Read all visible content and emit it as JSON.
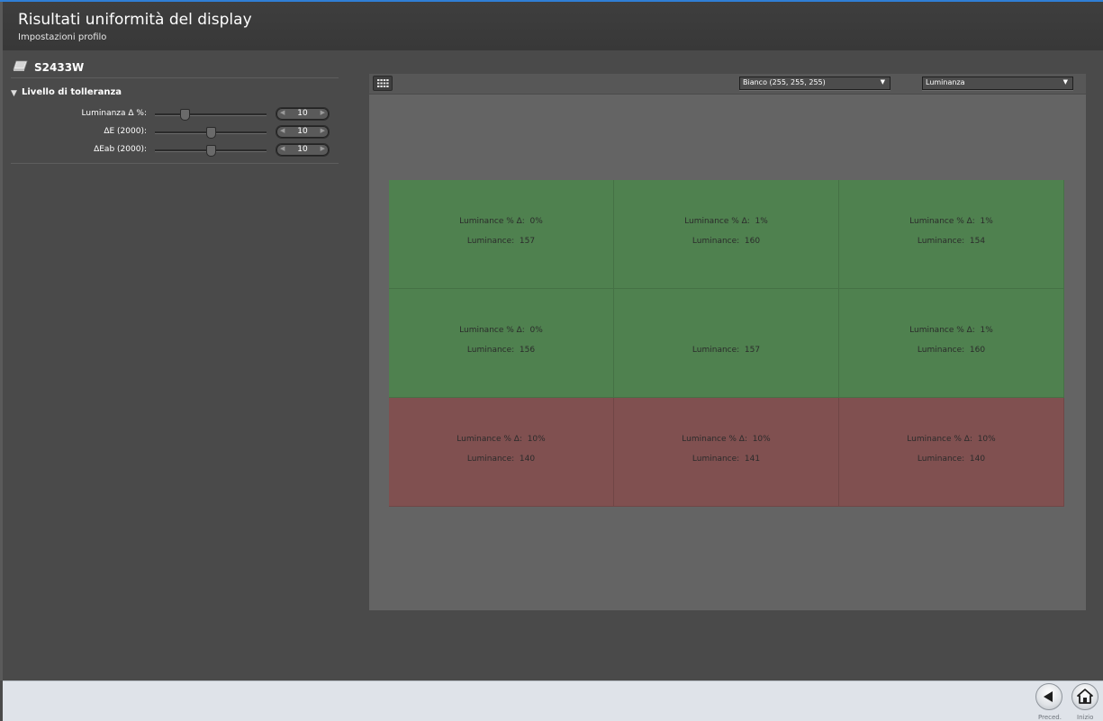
{
  "header": {
    "title": "Risultati uniformità del display",
    "subtitle": "Impostazioni profilo"
  },
  "sidebar": {
    "device_name": "S2433W",
    "section_title": "Livello di tolleranza",
    "tolerances": [
      {
        "label": "Luminanza Δ %:",
        "value": "10",
        "level": 0.27
      },
      {
        "label": "ΔE (2000):",
        "value": "10",
        "level": 0.5
      },
      {
        "label": "ΔEab (2000):",
        "value": "10",
        "level": 0.5
      }
    ]
  },
  "toolbar": {
    "color_select": "Bianco (255, 255, 255)",
    "metric_select": "Luminanza"
  },
  "grid": {
    "colors": {
      "pass": "#4f814f",
      "fail": "#805050"
    },
    "cells": [
      {
        "delta": "Luminance % Δ:  0%",
        "lum": "Luminance:  157",
        "status": "pass"
      },
      {
        "delta": "Luminance % Δ:  1%",
        "lum": "Luminance:  160",
        "status": "pass"
      },
      {
        "delta": "Luminance % Δ:  1%",
        "lum": "Luminance:  154",
        "status": "pass"
      },
      {
        "delta": "Luminance % Δ:  0%",
        "lum": "Luminance:  156",
        "status": "pass"
      },
      {
        "delta": "",
        "lum": "Luminance:  157",
        "status": "pass"
      },
      {
        "delta": "Luminance % Δ:  1%",
        "lum": "Luminance:  160",
        "status": "pass"
      },
      {
        "delta": "Luminance % Δ:  10%",
        "lum": "Luminance:  140",
        "status": "fail"
      },
      {
        "delta": "Luminance % Δ:  10%",
        "lum": "Luminance:  141",
        "status": "fail"
      },
      {
        "delta": "Luminance % Δ:  10%",
        "lum": "Luminance:  140",
        "status": "fail"
      }
    ]
  },
  "footer": {
    "prev_label": "Preced.",
    "home_label": "Inizio"
  }
}
